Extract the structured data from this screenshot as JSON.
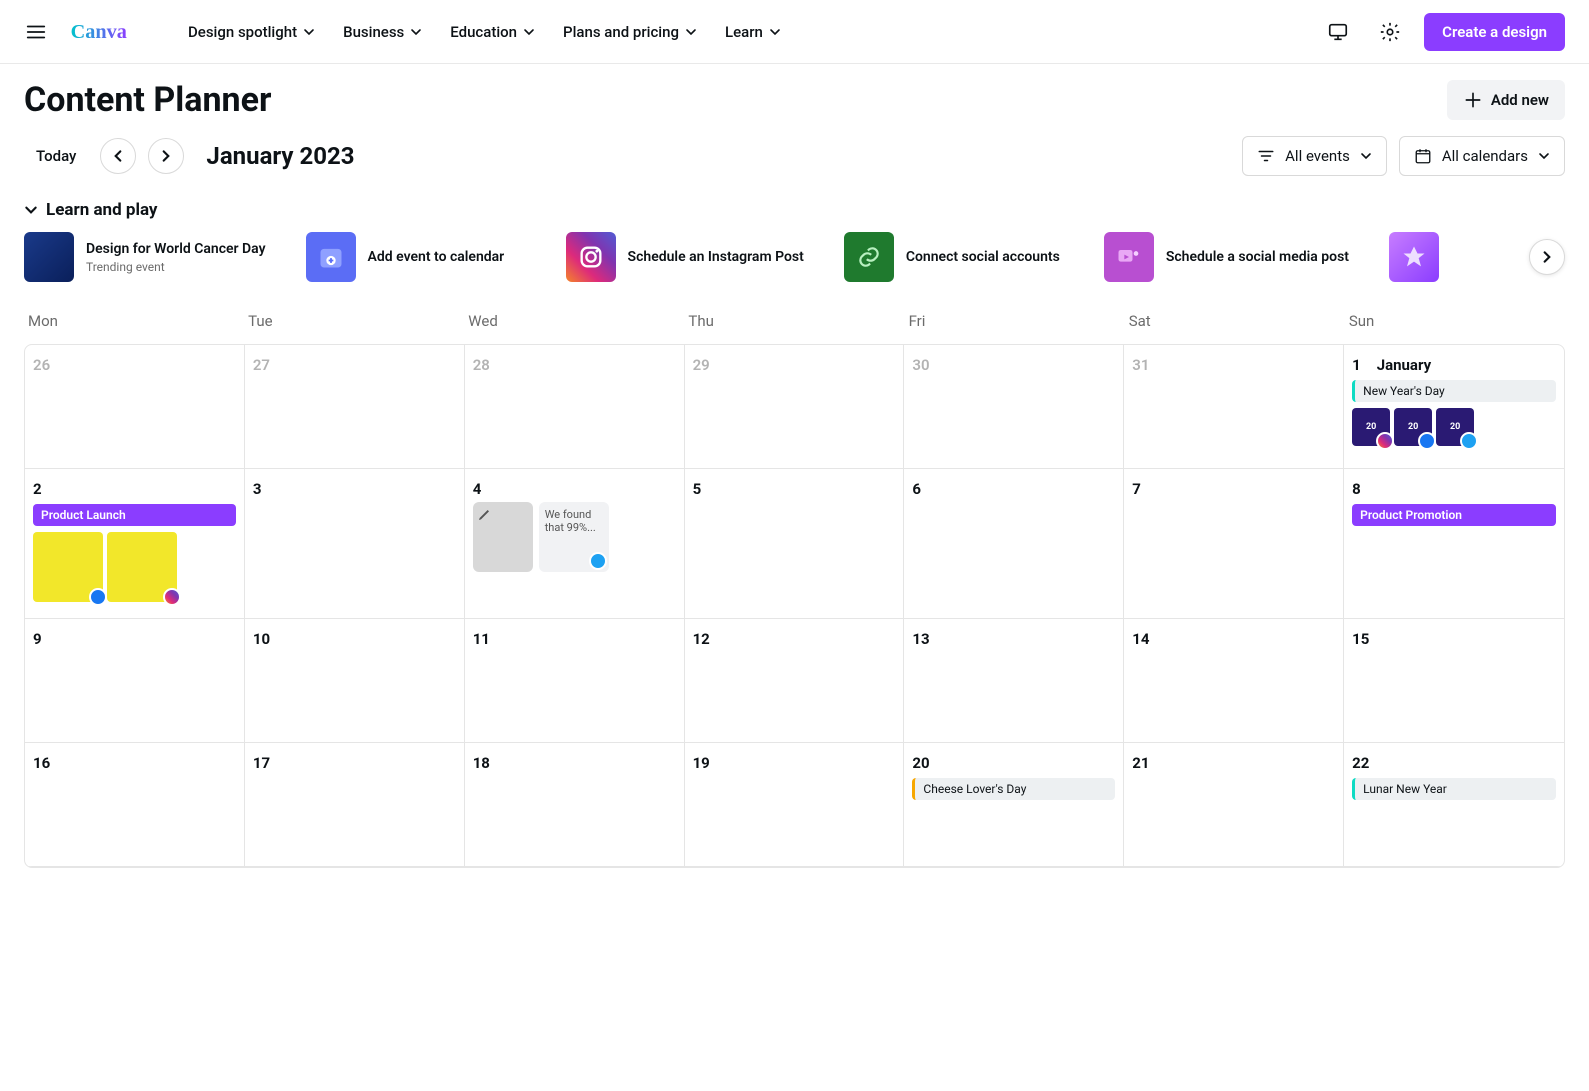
{
  "nav": {
    "items": [
      "Design spotlight",
      "Business",
      "Education",
      "Plans and pricing",
      "Learn"
    ],
    "createBtn": "Create a design"
  },
  "page": {
    "title": "Content Planner",
    "addNew": "Add new"
  },
  "controls": {
    "today": "Today",
    "month": "January 2023",
    "events": "All events",
    "calendars": "All calendars"
  },
  "learnPlay": {
    "header": "Learn and play",
    "cards": [
      {
        "title": "Design for World Cancer Day",
        "sub": "Trending event"
      },
      {
        "title": "Add event to calendar"
      },
      {
        "title": "Schedule an Instagram Post"
      },
      {
        "title": "Connect social accounts"
      },
      {
        "title": "Schedule a social media post"
      }
    ]
  },
  "dow": [
    "Mon",
    "Tue",
    "Wed",
    "Thu",
    "Fri",
    "Sat",
    "Sun"
  ],
  "cells": {
    "prev": [
      "26",
      "27",
      "28",
      "29",
      "30",
      "31"
    ],
    "jan1": {
      "num": "1",
      "month": "January",
      "event": "New Year's Day",
      "thumbTxt": "20"
    },
    "w2": [
      "2",
      "3",
      "4",
      "5",
      "6",
      "7",
      "8"
    ],
    "w3": [
      "9",
      "10",
      "11",
      "12",
      "13",
      "14",
      "15"
    ],
    "w4": [
      "16",
      "17",
      "18",
      "19",
      "20",
      "21",
      "22"
    ],
    "jan2event": "Product Launch",
    "jan4text": "We found that 99%...",
    "jan8event": "Product Promotion",
    "jan20event": "Cheese Lover's Day",
    "jan22event": "Lunar New Year"
  }
}
